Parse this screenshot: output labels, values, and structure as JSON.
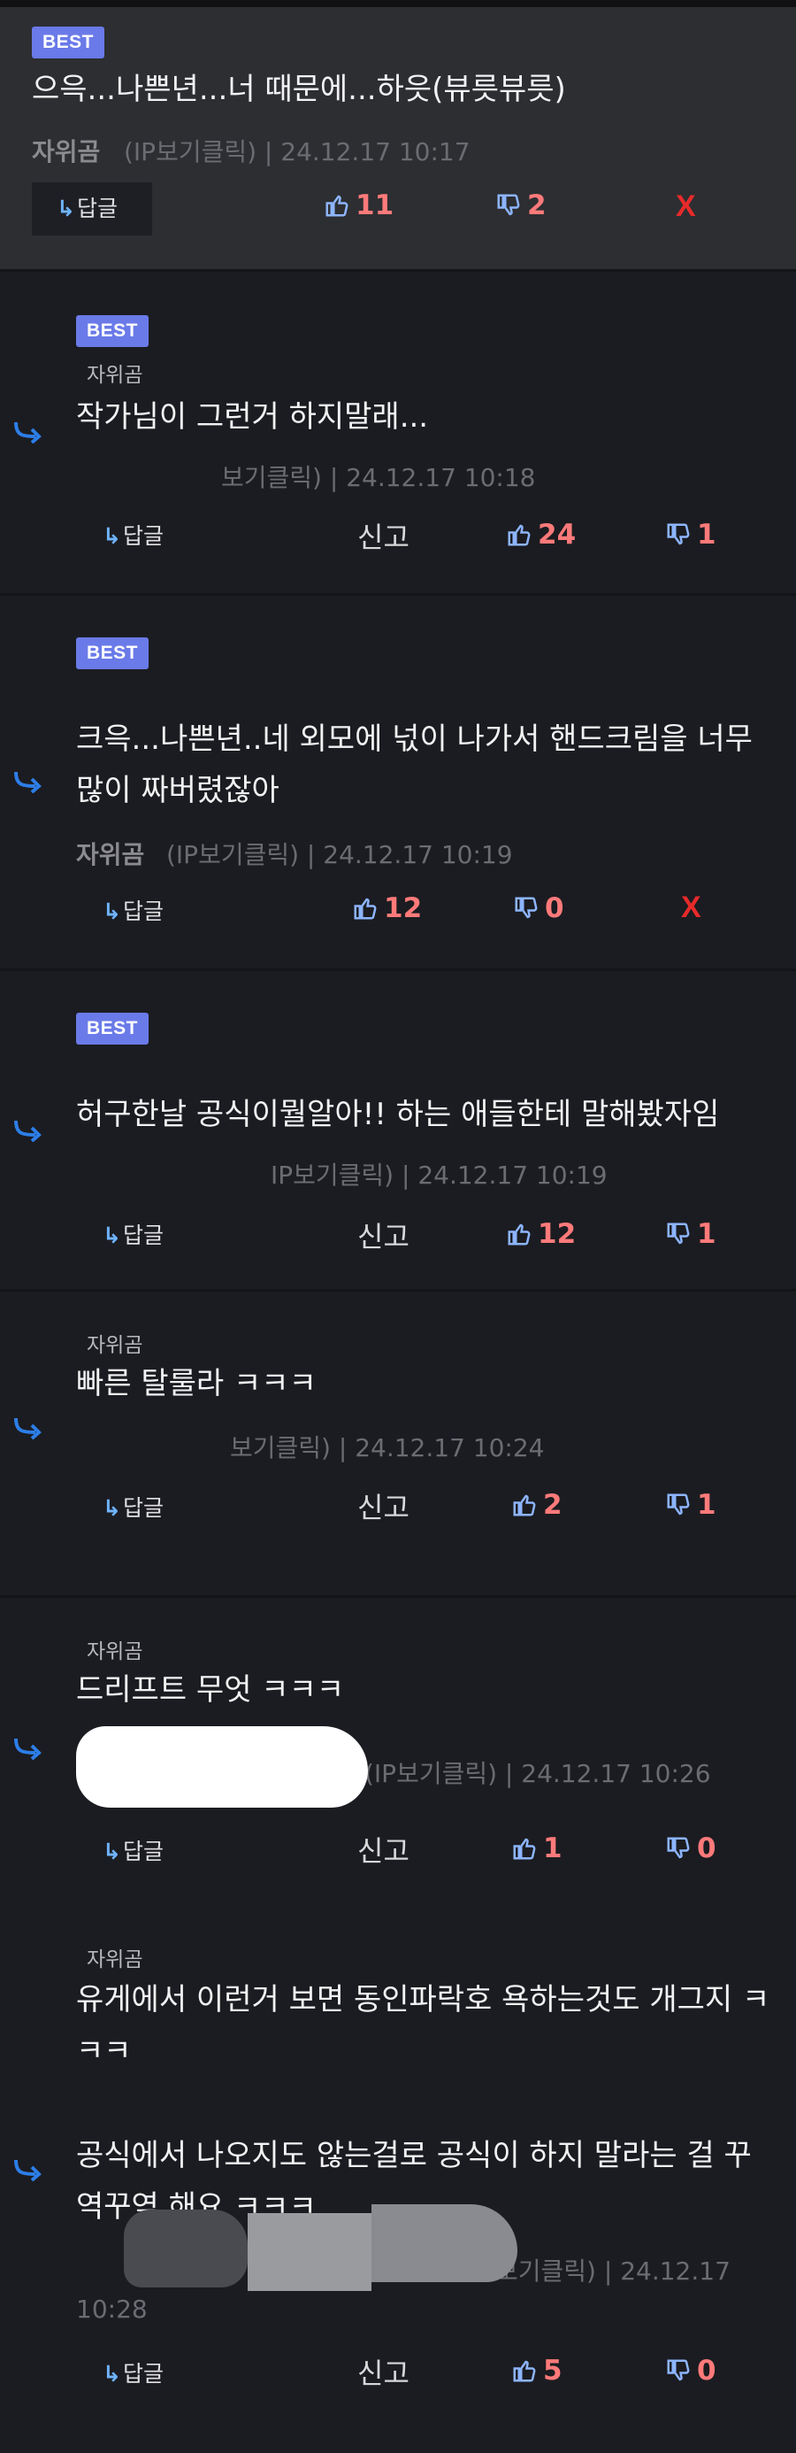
{
  "badge_label": "BEST",
  "reply_label": "답글",
  "report_label": "신고",
  "x_label": "X",
  "comments": [
    {
      "author": "자위곰",
      "text": "으윽...나쁜년...너 때문에...하읏(뷰릇뷰릇)",
      "meta": "(IP보기클릭) | 24.12.17 10:17",
      "up": "11",
      "down": "2"
    },
    {
      "author": "자위곰",
      "text": "작가님이 그런거 하지말래...",
      "meta": "보기클릭) | 24.12.17 10:18",
      "up": "24",
      "down": "1"
    },
    {
      "author": "자위곰",
      "text": "크윽...나쁜년..네 외모에 넋이 나가서 핸드크림을 너무 많이 짜버렸잖아",
      "meta": "(IP보기클릭) | 24.12.17 10:19",
      "up": "12",
      "down": "0"
    },
    {
      "text": "허구한날 공식이뭘알아!! 하는 애들한테 말해봤자임",
      "meta": "IP보기클릭) | 24.12.17 10:19",
      "up": "12",
      "down": "1"
    },
    {
      "author": "자위곰",
      "text": "빠른 탈룰라 ㅋㅋㅋ",
      "meta": "보기클릭) | 24.12.17 10:24",
      "up": "2",
      "down": "1"
    },
    {
      "author": "자위곰",
      "text": "드리프트 무엇 ㅋㅋㅋ",
      "meta": "(IP보기클릭) | 24.12.17 10:26",
      "up": "1",
      "down": "0"
    },
    {
      "author": "자위곰",
      "text1": "유게에서 이런거 보면  동인파락호 욕하는것도 개그지 ㅋㅋㅋ",
      "text2": "공식에서 나오지도 않는걸로 공식이 하지 말라는 걸 꾸역꾸역 해요 ㅋㅋㅋ",
      "meta": "보기클릭) | 24.12.17",
      "meta2": "10:28",
      "up": "5",
      "down": "0"
    }
  ]
}
